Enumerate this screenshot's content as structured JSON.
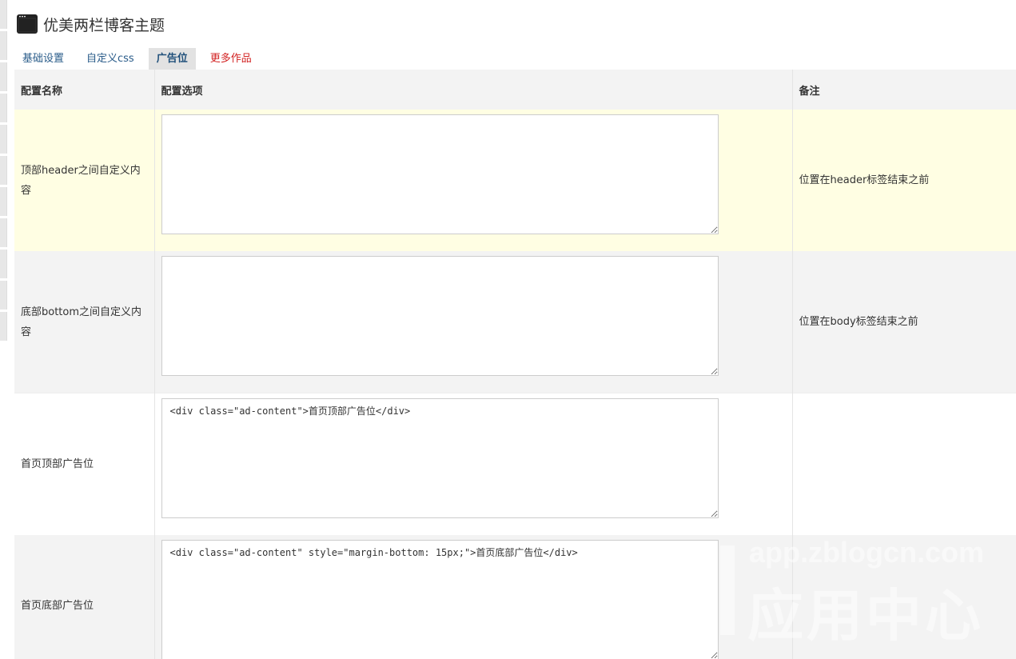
{
  "header": {
    "icon": "window-icon",
    "title": "优美两栏博客主题"
  },
  "tabs": [
    {
      "label": "基础设置",
      "active": false
    },
    {
      "label": "自定义css",
      "active": false
    },
    {
      "label": "广告位",
      "active": true
    },
    {
      "label": "更多作品",
      "active": false,
      "color": "#d22222"
    }
  ],
  "table": {
    "headers": [
      "配置名称",
      "配置选项",
      "备注"
    ],
    "rows": [
      {
        "name": "顶部header之间自定义内容",
        "value": "",
        "note": "位置在header标签结束之前"
      },
      {
        "name": "底部bottom之间自定义内容",
        "value": "",
        "note": "位置在body标签结束之前"
      },
      {
        "name": "首页顶部广告位",
        "value": "<div class=\"ad-content\">首页顶部广告位</div>",
        "note": ""
      },
      {
        "name": "首页底部广告位",
        "value": "<div class=\"ad-content\" style=\"margin-bottom: 15px;\">首页底部广告位</div>",
        "note": ""
      }
    ]
  },
  "watermark": {
    "url": "app.zblogcn.com",
    "text": "应用中心"
  },
  "colors": {
    "highlight_row": "#fffee3",
    "gray_row": "#f3f3f3",
    "link": "#2a5c8a",
    "red_link": "#d22222"
  }
}
